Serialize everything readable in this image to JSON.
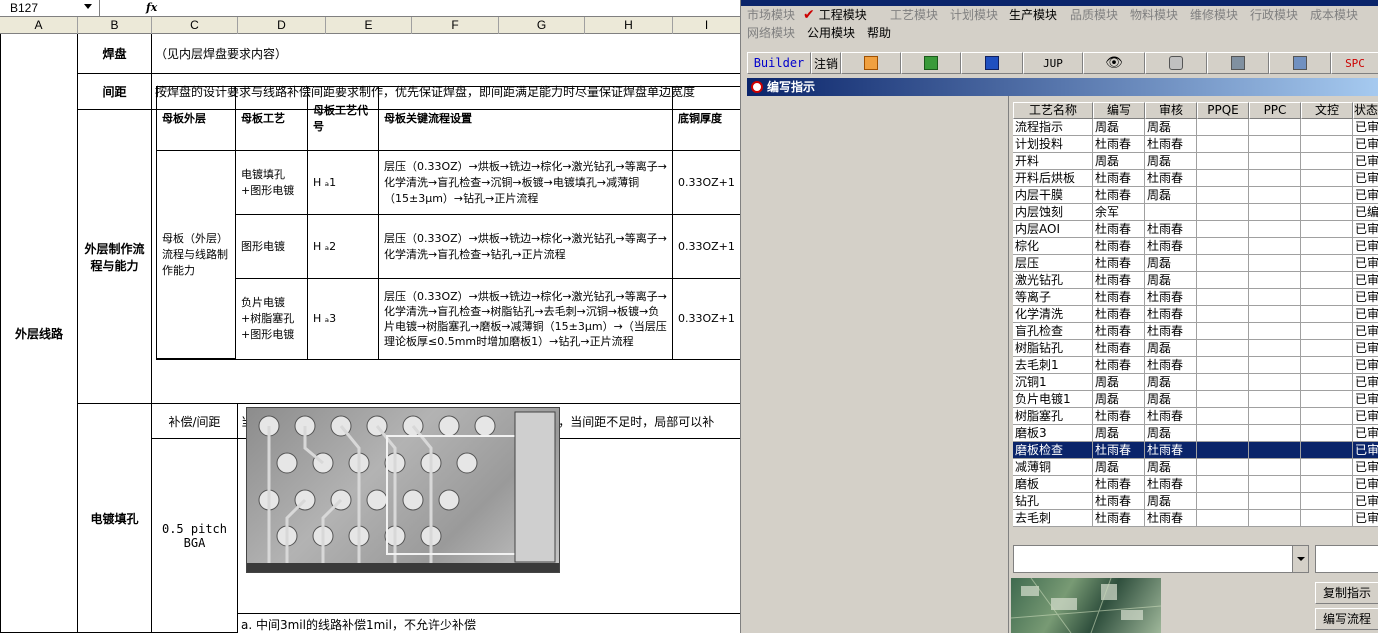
{
  "sheet": {
    "name_box": "B127",
    "fx_label": "fx",
    "columns": [
      "A",
      "B",
      "C",
      "D",
      "E",
      "F",
      "G",
      "H",
      "I"
    ],
    "section_label": "外层线路",
    "rows": {
      "pad_label": "焊盘",
      "pad_text": "（见内层焊盘要求内容）",
      "spacing_label": "间距",
      "spacing_text": "按焊盘的设计要求与线路补偿间距要求制作，优先保证焊盘，即间距满足能力时尽量保证焊盘单边宽度",
      "outer_label": "外层制作流程与能力",
      "plating_label": "电镀填孔",
      "comp_label": "补偿/间距",
      "comp_text": "当外层基铜为12或18um时，按补偿1.2mil，间距3mil制作，当间距不足时，局部可以补",
      "pitch_label": "0.5 pitch BGA",
      "note_text": "a. 中间3mil的线路补偿1mil，不允许少补偿"
    },
    "inner_table": {
      "headers": [
        "母板外层",
        "母板工艺",
        "母板工艺代号",
        "母板关键流程设置",
        "底铜厚度"
      ],
      "group_label": "母板（外层）流程与线路制作能力",
      "rows": [
        {
          "process": "电镀填孔+图形电镀",
          "code": "H ₐ1",
          "flow": "层压（0.33OZ）→烘板→铣边→棕化→激光钻孔→等离子→化学清洗→盲孔检查→沉铜→板镀→电镀填孔→减薄铜（15±3μm）→钻孔→正片流程",
          "copper": "0.33OZ+1"
        },
        {
          "process": "图形电镀",
          "code": "H ₐ2",
          "flow": "层压（0.33OZ）→烘板→铣边→棕化→激光钻孔→等离子→化学清洗→盲孔检查→钻孔→正片流程",
          "copper": "0.33OZ+1"
        },
        {
          "process": "负片电镀+树脂塞孔+图形电镀",
          "code": "H ₐ3",
          "flow": "层压（0.33OZ）→烘板→铣边→棕化→激光钻孔→等离子→化学清洗→盲孔检查→树脂钻孔→去毛刺→沉铜→板镀→负片电镀→树脂塞孔→磨板→减薄铜（15±3μm）→（当层压理论板厚≤0.5mm时增加磨板1）→钻孔→正片流程",
          "copper": "0.33OZ+1"
        }
      ]
    }
  },
  "app": {
    "menu_row1": [
      {
        "label": "市场模块",
        "active": false
      },
      {
        "label": "工程模块",
        "active": true
      },
      {
        "label": "工艺模块",
        "active": false
      },
      {
        "label": "计划模块",
        "active": false
      },
      {
        "label": "生产模块",
        "active": true
      },
      {
        "label": "品质模块",
        "active": false
      },
      {
        "label": "物料模块",
        "active": false
      },
      {
        "label": "维修模块",
        "active": false
      },
      {
        "label": "行政模块",
        "active": false
      },
      {
        "label": "成本模块",
        "active": false
      }
    ],
    "menu_row2": [
      {
        "label": "网络模块",
        "active": false
      },
      {
        "label": "公用模块",
        "active": true
      },
      {
        "label": "帮助",
        "active": true
      }
    ],
    "toolbar": {
      "builder": "Builder",
      "logout": "注销",
      "jup": "JUP",
      "spc": "SPC"
    },
    "panel_title": "编写指示",
    "grid": {
      "headers": [
        "工艺名称",
        "编写",
        "审核",
        "PPQE",
        "PPC",
        "文控",
        "状态"
      ],
      "rows": [
        {
          "name": "流程指示",
          "writer": "周磊",
          "reviewer": "周磊",
          "status": "已审核"
        },
        {
          "name": "计划投料",
          "writer": "杜雨春",
          "reviewer": "杜雨春",
          "status": "已审核"
        },
        {
          "name": "开料",
          "writer": "周磊",
          "reviewer": "周磊",
          "status": "已审核"
        },
        {
          "name": "开料后烘板",
          "writer": "杜雨春",
          "reviewer": "杜雨春",
          "status": "已审核"
        },
        {
          "name": "内层干膜",
          "writer": "杜雨春",
          "reviewer": "周磊",
          "status": "已审核"
        },
        {
          "name": "内层蚀刻",
          "writer": "余军",
          "reviewer": "",
          "status": "已编写"
        },
        {
          "name": "内层AOI",
          "writer": "杜雨春",
          "reviewer": "杜雨春",
          "status": "已审核"
        },
        {
          "name": "棕化",
          "writer": "杜雨春",
          "reviewer": "杜雨春",
          "status": "已审核"
        },
        {
          "name": "层压",
          "writer": "杜雨春",
          "reviewer": "周磊",
          "status": "已审核"
        },
        {
          "name": "激光钻孔",
          "writer": "杜雨春",
          "reviewer": "周磊",
          "status": "已审核"
        },
        {
          "name": "等离子",
          "writer": "杜雨春",
          "reviewer": "杜雨春",
          "status": "已审核"
        },
        {
          "name": "化学清洗",
          "writer": "杜雨春",
          "reviewer": "杜雨春",
          "status": "已审核"
        },
        {
          "name": "盲孔检查",
          "writer": "杜雨春",
          "reviewer": "杜雨春",
          "status": "已审核"
        },
        {
          "name": "树脂钻孔",
          "writer": "杜雨春",
          "reviewer": "周磊",
          "status": "已审核"
        },
        {
          "name": "去毛刺1",
          "writer": "杜雨春",
          "reviewer": "杜雨春",
          "status": "已审核"
        },
        {
          "name": "沉铜1",
          "writer": "周磊",
          "reviewer": "周磊",
          "status": "已审核"
        },
        {
          "name": "负片电镀1",
          "writer": "周磊",
          "reviewer": "周磊",
          "status": "已审核"
        },
        {
          "name": "树脂塞孔",
          "writer": "杜雨春",
          "reviewer": "杜雨春",
          "status": "已审核"
        },
        {
          "name": "磨板3",
          "writer": "周磊",
          "reviewer": "周磊",
          "status": "已审核"
        },
        {
          "name": "磨板检查",
          "writer": "杜雨春",
          "reviewer": "杜雨春",
          "status": "已审核",
          "selected": true
        },
        {
          "name": "减薄铜",
          "writer": "周磊",
          "reviewer": "周磊",
          "status": "已审核"
        },
        {
          "name": "磨板",
          "writer": "杜雨春",
          "reviewer": "杜雨春",
          "status": "已审核"
        },
        {
          "name": "钻孔",
          "writer": "杜雨春",
          "reviewer": "周磊",
          "status": "已审核"
        },
        {
          "name": "去毛刺",
          "writer": "杜雨春",
          "reviewer": "杜雨春",
          "status": "已审核"
        }
      ]
    },
    "buttons": {
      "copy": "复制指示",
      "edit_flow": "编写流程"
    }
  }
}
